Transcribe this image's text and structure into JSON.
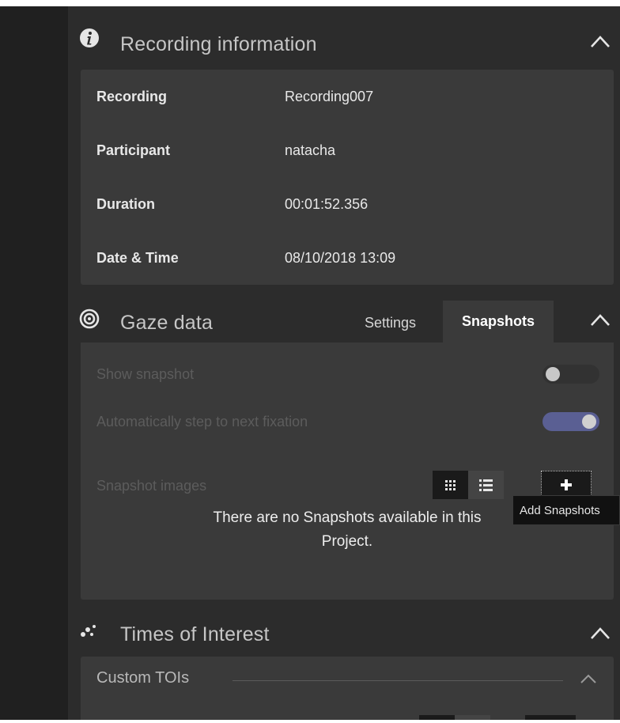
{
  "recording_info": {
    "title": "Recording information",
    "rows": [
      {
        "label": "Recording",
        "value": "Recording007"
      },
      {
        "label": "Participant",
        "value": "natacha"
      },
      {
        "label": "Duration",
        "value": "00:01:52.356"
      },
      {
        "label": "Date & Time",
        "value": "08/10/2018 13:09"
      }
    ]
  },
  "gaze_data": {
    "title": "Gaze data",
    "tabs": [
      {
        "label": "Settings",
        "active": false
      },
      {
        "label": "Snapshots",
        "active": true
      }
    ],
    "settings": {
      "show_snapshot": {
        "label": "Show snapshot",
        "on": false
      },
      "auto_step": {
        "label": "Automatically step to next fixation",
        "on": true
      }
    },
    "snapshot_images_label": "Snapshot images",
    "add_tooltip": "Add Snapshots",
    "empty_message_line1": "There are no Snapshots available in this",
    "empty_message_line2": "Project."
  },
  "times_of_interest": {
    "title": "Times of Interest",
    "custom_tois": "Custom TOIs"
  },
  "colors": {
    "toggle_on": "#5a5f93",
    "toggle_off": "#323232",
    "panel_bg": "#2c2c2c",
    "card_bg": "#3a3a3a"
  }
}
